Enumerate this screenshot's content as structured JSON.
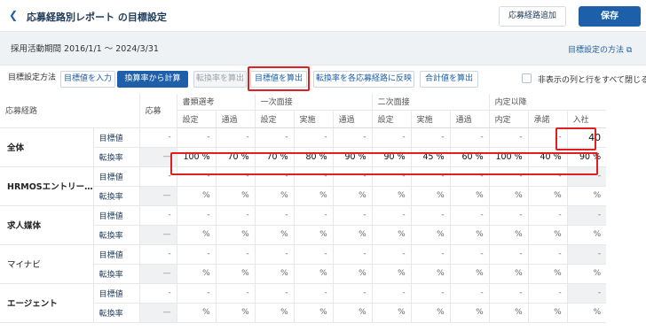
{
  "header": {
    "back_icon": "chevron-left-icon",
    "title": "応募経路別レポート の目標設定",
    "add_route_label": "応募経路追加",
    "save_label": "保存"
  },
  "period": {
    "text": "採用活動期間  2016/1/1 〜 2024/3/31",
    "help_label": "目標設定の方法 ⧉"
  },
  "toolbar": {
    "method_label": "目標設定方法",
    "input_target_label": "目標値を入力",
    "calc_from_rate_label": "換算率から計算",
    "calc_rate_label": "転換率を算出",
    "calc_target_label": "目標値を算出",
    "apply_rate_label": "転換率を各応募経路に反映",
    "calc_total_label": "合計値を算出",
    "hide_empty_label": "非表示の列と行をすべて閉じる"
  },
  "table": {
    "route_header": "応募経路",
    "apply_header": "応募",
    "groups": [
      "書類選考",
      "一次面接",
      "二次面接",
      "内定以降"
    ],
    "sub_headers": [
      "設定",
      "通過",
      "設定",
      "実施",
      "通過",
      "設定",
      "実施",
      "通過",
      "内定",
      "承諾",
      "入社"
    ],
    "row_labels": {
      "target": "目標値",
      "rate": "転換率"
    },
    "routes": [
      {
        "name": "全体",
        "target": {
          "apply": "-",
          "cells": [
            "-",
            "-",
            "-",
            "-",
            "-",
            "-",
            "-",
            "-",
            "-",
            "-",
            "40"
          ]
        },
        "rate": {
          "apply": "—",
          "cells": [
            "100 %",
            "70 %",
            "70 %",
            "80 %",
            "90 %",
            "90 %",
            "45 %",
            "60 %",
            "100 %",
            "40 %",
            "90 %"
          ]
        }
      },
      {
        "name": "HRMOSエントリー…",
        "target": {
          "apply": "-",
          "cells": [
            "-",
            "-",
            "-",
            "-",
            "-",
            "-",
            "-",
            "-",
            "-",
            "-",
            "-"
          ]
        },
        "rate": {
          "apply": "—",
          "cells": [
            "%",
            "%",
            "%",
            "%",
            "%",
            "%",
            "%",
            "%",
            "%",
            "%",
            "%"
          ]
        }
      },
      {
        "name": "求人媒体",
        "target": {
          "apply": "-",
          "cells": [
            "-",
            "-",
            "-",
            "-",
            "-",
            "-",
            "-",
            "-",
            "-",
            "-",
            "-"
          ]
        },
        "rate": {
          "apply": "—",
          "cells": [
            "%",
            "%",
            "%",
            "%",
            "%",
            "%",
            "%",
            "%",
            "%",
            "%",
            "%"
          ]
        }
      },
      {
        "name": "マイナビ",
        "target": {
          "apply": "-",
          "cells": [
            "-",
            "-",
            "-",
            "-",
            "-",
            "-",
            "-",
            "-",
            "-",
            "-",
            "-"
          ]
        },
        "rate": {
          "apply": "—",
          "cells": [
            "%",
            "%",
            "%",
            "%",
            "%",
            "%",
            "%",
            "%",
            "%",
            "%",
            "%"
          ]
        }
      },
      {
        "name": "エージェント",
        "target": {
          "apply": "-",
          "cells": [
            "-",
            "-",
            "-",
            "-",
            "-",
            "-",
            "-",
            "-",
            "-",
            "-",
            "-"
          ]
        },
        "rate": {
          "apply": "—",
          "cells": [
            "%",
            "%",
            "%",
            "%",
            "%",
            "%",
            "%",
            "%",
            "%",
            "%",
            "%"
          ]
        }
      }
    ]
  },
  "colors": {
    "accent": "#1d5fa8",
    "highlight": "#e02020"
  }
}
